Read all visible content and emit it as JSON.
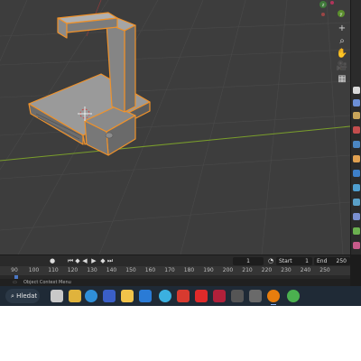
{
  "viewport": {
    "view_tools": [
      "+",
      "⌕",
      "✋",
      "🎥",
      "▦"
    ],
    "gizmo_axes": [
      "z",
      "y"
    ]
  },
  "timeline": {
    "current_frame": "1",
    "start_label": "Start",
    "start_value": "1",
    "end_label": "End",
    "end_value": "250"
  },
  "ruler": {
    "ticks": [
      "90",
      "100",
      "110",
      "120",
      "130",
      "140",
      "150",
      "160",
      "170",
      "180",
      "190",
      "200",
      "210",
      "220",
      "230",
      "240",
      "250"
    ]
  },
  "status_bar": {
    "text": "Object Context Menu"
  },
  "taskbar": {
    "search_label": "Hledat",
    "apps": [
      "file-explorer",
      "edge",
      "store",
      "file-folder",
      "mail",
      "chrome",
      "antivirus",
      "youtube",
      "media",
      "gog",
      "dropbox",
      "blender",
      "chrome-alt"
    ]
  },
  "colors": {
    "viewport_bg": "#3d3d3d",
    "grid": "#4a4a4a",
    "x_axis": "#7a9e2b",
    "selection_outline": "#f0922a",
    "model_fill": "#7f7f7f"
  }
}
